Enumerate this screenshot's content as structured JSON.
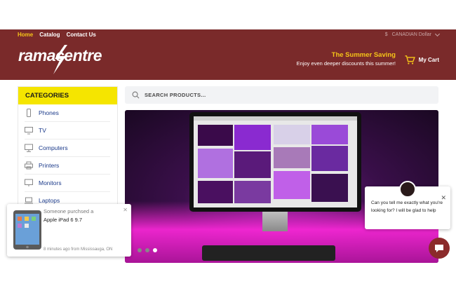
{
  "nav": {
    "items": [
      {
        "label": "Home",
        "active": true
      },
      {
        "label": "Catalog",
        "active": false
      },
      {
        "label": "Contact Us",
        "active": false
      }
    ],
    "currency_symbol": "$",
    "currency_label": "CANADIAN Dollar"
  },
  "brand": {
    "logo_text": "ramacentre"
  },
  "promo": {
    "title": "The Summer Saving",
    "subtitle": "Enjoy even deeper discounts this summer!"
  },
  "cart": {
    "label": "My Cart",
    "icon": "cart-icon"
  },
  "categories": {
    "heading": "CATEGORIES",
    "items": [
      {
        "label": "Phones",
        "icon": "phone-icon"
      },
      {
        "label": "TV",
        "icon": "tv-icon"
      },
      {
        "label": "Computers",
        "icon": "computer-icon"
      },
      {
        "label": "Printers",
        "icon": "printer-icon"
      },
      {
        "label": "Monitors",
        "icon": "monitor-icon"
      },
      {
        "label": "Laptops",
        "icon": "laptop-icon"
      }
    ]
  },
  "search": {
    "placeholder": "SEARCH PRODUCTS..."
  },
  "hero": {
    "slide_count": 3,
    "active_slide": 3
  },
  "purchase_popup": {
    "line1": "Someone purchsed a",
    "product": "Apple iPad 6 9.7",
    "meta": "8 minutes ago from Mississauga, ON"
  },
  "chat": {
    "message": "Can you tell me exactly what you're looking for? I will be glad to help"
  },
  "colors": {
    "header_bg": "#7a2a2a",
    "accent_yellow": "#f5c518",
    "category_head": "#f5e500",
    "link_blue": "#1b3a8a"
  }
}
